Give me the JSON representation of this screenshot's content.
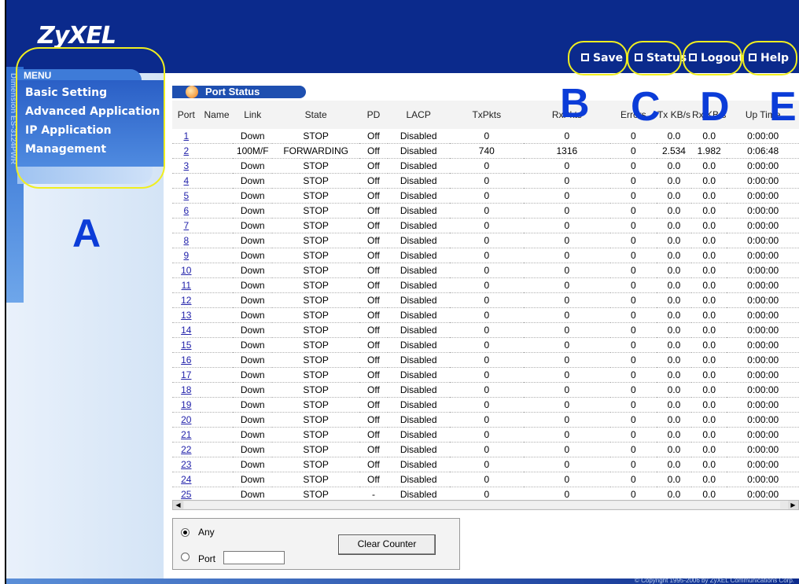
{
  "logo": "ZyXEL",
  "side_strip_text": "Dimension ES-3124PWR",
  "menu": {
    "title": "MENU",
    "items": [
      "Basic Setting",
      "Advanced Application",
      "IP Application",
      "Management"
    ]
  },
  "topbar": {
    "save": "Save",
    "status": "Status",
    "logout": "Logout",
    "help": "Help"
  },
  "callouts": {
    "a": "A",
    "b": "B",
    "c": "C",
    "d": "D",
    "e": "E"
  },
  "section_title": "Port Status",
  "table": {
    "headers": [
      "Port",
      "Name",
      "Link",
      "State",
      "PD",
      "LACP",
      "TxPkts",
      "RxPkts",
      "Errors",
      "Tx KB/s",
      "Rx KB/s",
      "Up Time"
    ],
    "rows": [
      [
        "1",
        "",
        "Down",
        "STOP",
        "Off",
        "Disabled",
        "0",
        "0",
        "0",
        "0.0",
        "0.0",
        "0:00:00"
      ],
      [
        "2",
        "",
        "100M/F",
        "FORWARDING",
        "Off",
        "Disabled",
        "740",
        "1316",
        "0",
        "2.534",
        "1.982",
        "0:06:48"
      ],
      [
        "3",
        "",
        "Down",
        "STOP",
        "Off",
        "Disabled",
        "0",
        "0",
        "0",
        "0.0",
        "0.0",
        "0:00:00"
      ],
      [
        "4",
        "",
        "Down",
        "STOP",
        "Off",
        "Disabled",
        "0",
        "0",
        "0",
        "0.0",
        "0.0",
        "0:00:00"
      ],
      [
        "5",
        "",
        "Down",
        "STOP",
        "Off",
        "Disabled",
        "0",
        "0",
        "0",
        "0.0",
        "0.0",
        "0:00:00"
      ],
      [
        "6",
        "",
        "Down",
        "STOP",
        "Off",
        "Disabled",
        "0",
        "0",
        "0",
        "0.0",
        "0.0",
        "0:00:00"
      ],
      [
        "7",
        "",
        "Down",
        "STOP",
        "Off",
        "Disabled",
        "0",
        "0",
        "0",
        "0.0",
        "0.0",
        "0:00:00"
      ],
      [
        "8",
        "",
        "Down",
        "STOP",
        "Off",
        "Disabled",
        "0",
        "0",
        "0",
        "0.0",
        "0.0",
        "0:00:00"
      ],
      [
        "9",
        "",
        "Down",
        "STOP",
        "Off",
        "Disabled",
        "0",
        "0",
        "0",
        "0.0",
        "0.0",
        "0:00:00"
      ],
      [
        "10",
        "",
        "Down",
        "STOP",
        "Off",
        "Disabled",
        "0",
        "0",
        "0",
        "0.0",
        "0.0",
        "0:00:00"
      ],
      [
        "11",
        "",
        "Down",
        "STOP",
        "Off",
        "Disabled",
        "0",
        "0",
        "0",
        "0.0",
        "0.0",
        "0:00:00"
      ],
      [
        "12",
        "",
        "Down",
        "STOP",
        "Off",
        "Disabled",
        "0",
        "0",
        "0",
        "0.0",
        "0.0",
        "0:00:00"
      ],
      [
        "13",
        "",
        "Down",
        "STOP",
        "Off",
        "Disabled",
        "0",
        "0",
        "0",
        "0.0",
        "0.0",
        "0:00:00"
      ],
      [
        "14",
        "",
        "Down",
        "STOP",
        "Off",
        "Disabled",
        "0",
        "0",
        "0",
        "0.0",
        "0.0",
        "0:00:00"
      ],
      [
        "15",
        "",
        "Down",
        "STOP",
        "Off",
        "Disabled",
        "0",
        "0",
        "0",
        "0.0",
        "0.0",
        "0:00:00"
      ],
      [
        "16",
        "",
        "Down",
        "STOP",
        "Off",
        "Disabled",
        "0",
        "0",
        "0",
        "0.0",
        "0.0",
        "0:00:00"
      ],
      [
        "17",
        "",
        "Down",
        "STOP",
        "Off",
        "Disabled",
        "0",
        "0",
        "0",
        "0.0",
        "0.0",
        "0:00:00"
      ],
      [
        "18",
        "",
        "Down",
        "STOP",
        "Off",
        "Disabled",
        "0",
        "0",
        "0",
        "0.0",
        "0.0",
        "0:00:00"
      ],
      [
        "19",
        "",
        "Down",
        "STOP",
        "Off",
        "Disabled",
        "0",
        "0",
        "0",
        "0.0",
        "0.0",
        "0:00:00"
      ],
      [
        "20",
        "",
        "Down",
        "STOP",
        "Off",
        "Disabled",
        "0",
        "0",
        "0",
        "0.0",
        "0.0",
        "0:00:00"
      ],
      [
        "21",
        "",
        "Down",
        "STOP",
        "Off",
        "Disabled",
        "0",
        "0",
        "0",
        "0.0",
        "0.0",
        "0:00:00"
      ],
      [
        "22",
        "",
        "Down",
        "STOP",
        "Off",
        "Disabled",
        "0",
        "0",
        "0",
        "0.0",
        "0.0",
        "0:00:00"
      ],
      [
        "23",
        "",
        "Down",
        "STOP",
        "Off",
        "Disabled",
        "0",
        "0",
        "0",
        "0.0",
        "0.0",
        "0:00:00"
      ],
      [
        "24",
        "",
        "Down",
        "STOP",
        "Off",
        "Disabled",
        "0",
        "0",
        "0",
        "0.0",
        "0.0",
        "0:00:00"
      ],
      [
        "25",
        "",
        "Down",
        "STOP",
        "-",
        "Disabled",
        "0",
        "0",
        "0",
        "0.0",
        "0.0",
        "0:00:00"
      ]
    ]
  },
  "counter_panel": {
    "any_label": "Any",
    "port_label": "Port",
    "port_value": "",
    "selected": "any",
    "clear_button": "Clear Counter"
  },
  "footer_text": "© Copyright 1995-2006 by ZyXEL Communications Corp."
}
